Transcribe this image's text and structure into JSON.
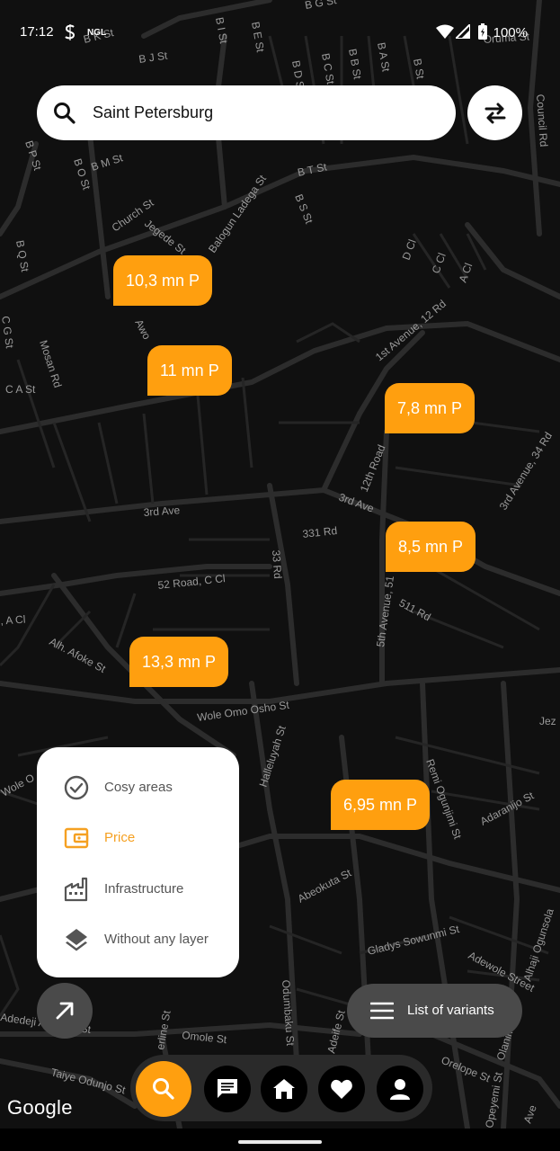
{
  "status_bar": {
    "time": "17:12",
    "battery": "100%",
    "icons": [
      "notification-s-icon",
      "ngl-icon",
      "wifi-icon",
      "signal-icon",
      "battery-icon"
    ],
    "app_badge": "NGL"
  },
  "search": {
    "value": "Saint Petersburg",
    "icon": "search-icon"
  },
  "swap_button": {
    "icon": "swap-arrows-icon"
  },
  "map": {
    "streets": [
      "B J St",
      "B K St",
      "B G St",
      "B I St",
      "B E St",
      "B D St",
      "B C St",
      "B B St",
      "B A St",
      "B St",
      "Oruma St",
      "Council Rd",
      "B P St",
      "B O St",
      "B M St",
      "B T St",
      "B S St",
      "Church St",
      "Jegede St",
      "Balogun Ladega St",
      "D Cl",
      "C Cl",
      "A Cl",
      "B Q St",
      "C G St",
      "Mosan Rd",
      "C A St",
      "Awo",
      "1st Avenue, 12 Rd",
      "12th Road",
      "3rd Ave",
      "3rd Avenue, 34 Rd",
      "331 Rd",
      "52 Road, C Cl",
      "33 Rd",
      "5th Avenue, 51",
      "511 Rd",
      "Alh. Afoke St",
      "Wole Omo Osho St",
      "Jez",
      "Wole O",
      "Halleluyah St",
      "Remi Ogunjimi St",
      "Adaranijo St",
      "Abeokuta St",
      "Gladys Sowunmi St",
      "Adewole Street",
      "Alhaji Ogunsola",
      "Odumbaku St",
      "Adeife St",
      "Omole St",
      "Adedeji Adebola St",
      "Taiye Odunjo St",
      "Orelope St",
      "Olanimi St",
      "Opeyemi St",
      "Ave",
      "d, A Cl",
      "erline St"
    ]
  },
  "markers": [
    {
      "label": "10,3 mn P"
    },
    {
      "label": "11 mn P"
    },
    {
      "label": "7,8 mn P"
    },
    {
      "label": "8,5 mn P"
    },
    {
      "label": "13,3 mn P"
    },
    {
      "label": "6,95 mn P"
    }
  ],
  "layer_panel": {
    "items": [
      {
        "label": "Cosy areas",
        "icon": "check-circle-icon",
        "active": false
      },
      {
        "label": "Price",
        "icon": "wallet-icon",
        "active": true
      },
      {
        "label": "Infrastructure",
        "icon": "factory-icon",
        "active": false
      },
      {
        "label": "Without any layer",
        "icon": "layers-icon",
        "active": false
      }
    ],
    "active_color": "#f5a021"
  },
  "expand_button": {
    "icon": "arrow-up-right-icon"
  },
  "list_button": {
    "label": "List of variants",
    "icon": "menu-icon"
  },
  "bottom_nav": {
    "items": [
      {
        "icon": "search-icon",
        "active": true
      },
      {
        "icon": "chat-icon",
        "active": false
      },
      {
        "icon": "home-icon",
        "active": false
      },
      {
        "icon": "heart-icon",
        "active": false
      },
      {
        "icon": "person-icon",
        "active": false
      }
    ]
  },
  "google_logo": "Google",
  "colors": {
    "accent": "#ff9f0f",
    "map_bg": "#101010",
    "road": "#2e2e2e"
  }
}
